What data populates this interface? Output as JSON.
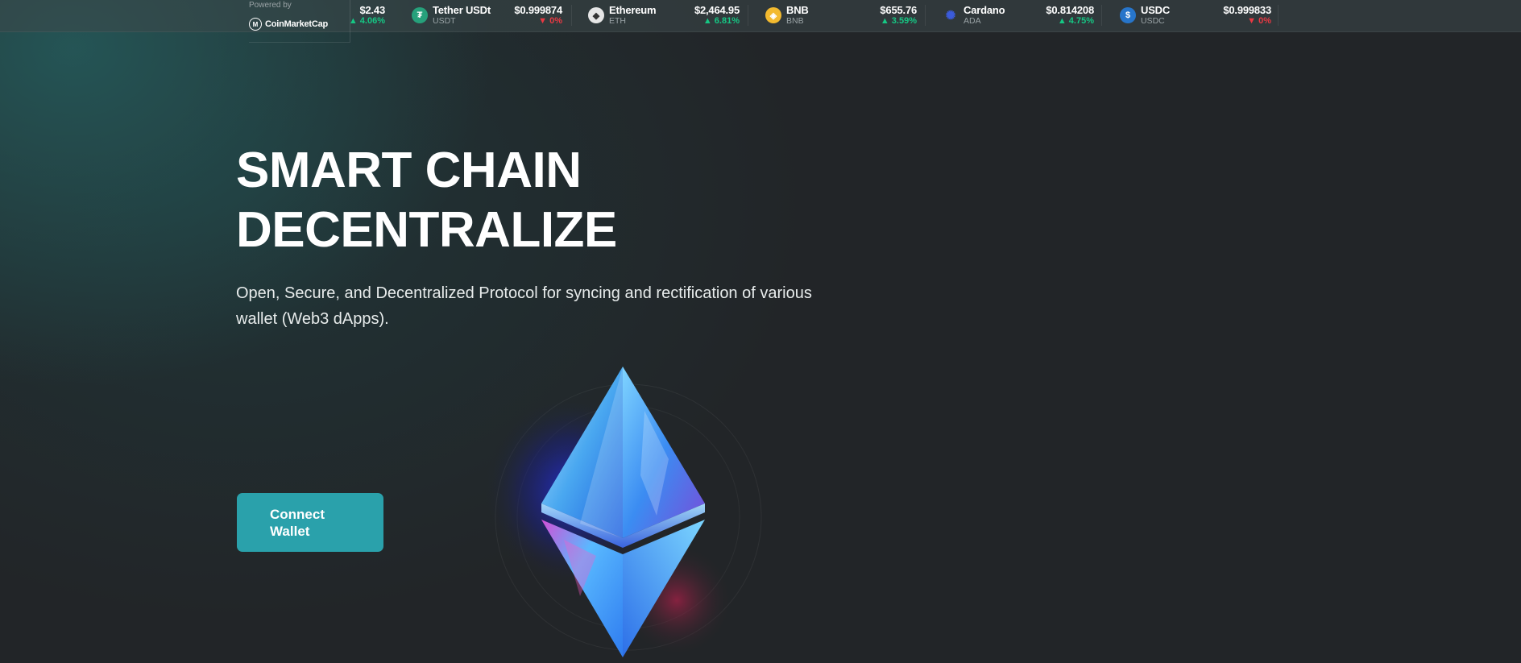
{
  "ticker": {
    "powered_by": "Powered by",
    "brand": "CoinMarketCap",
    "partial": {
      "price": "$2.43",
      "change": "4.06%",
      "direction": "up"
    },
    "coins": [
      {
        "name": "Tether USDt",
        "symbol": "USDT",
        "price": "$0.999874",
        "change": "0%",
        "direction": "down",
        "icon": "tether-icon",
        "icon_color": "#26a17b"
      },
      {
        "name": "Ethereum",
        "symbol": "ETH",
        "price": "$2,464.95",
        "change": "6.81%",
        "direction": "up",
        "icon": "ethereum-icon",
        "icon_color": "#e6e6e6"
      },
      {
        "name": "BNB",
        "symbol": "BNB",
        "price": "$655.76",
        "change": "3.59%",
        "direction": "up",
        "icon": "bnb-icon",
        "icon_color": "#f3ba2f"
      },
      {
        "name": "Cardano",
        "symbol": "ADA",
        "price": "$0.814208",
        "change": "4.75%",
        "direction": "up",
        "icon": "cardano-icon",
        "icon_color": "#0033ad"
      },
      {
        "name": "USDC",
        "symbol": "USDC",
        "price": "$0.999833",
        "change": "0%",
        "direction": "down",
        "icon": "usdc-icon",
        "icon_color": "#2775ca"
      }
    ]
  },
  "hero": {
    "title_line1": "SMART CHAIN",
    "title_line2": "DECENTRALIZE",
    "subtitle": "Open, Secure, and Decentralized Protocol for syncing and rectification of various wallet (Web3 dApps).",
    "cta_line1": "Connect",
    "cta_line2": "Wallet"
  },
  "colors": {
    "accent": "#2aa1ab",
    "up": "#16c784",
    "down": "#ea3943",
    "background": "#222528"
  }
}
